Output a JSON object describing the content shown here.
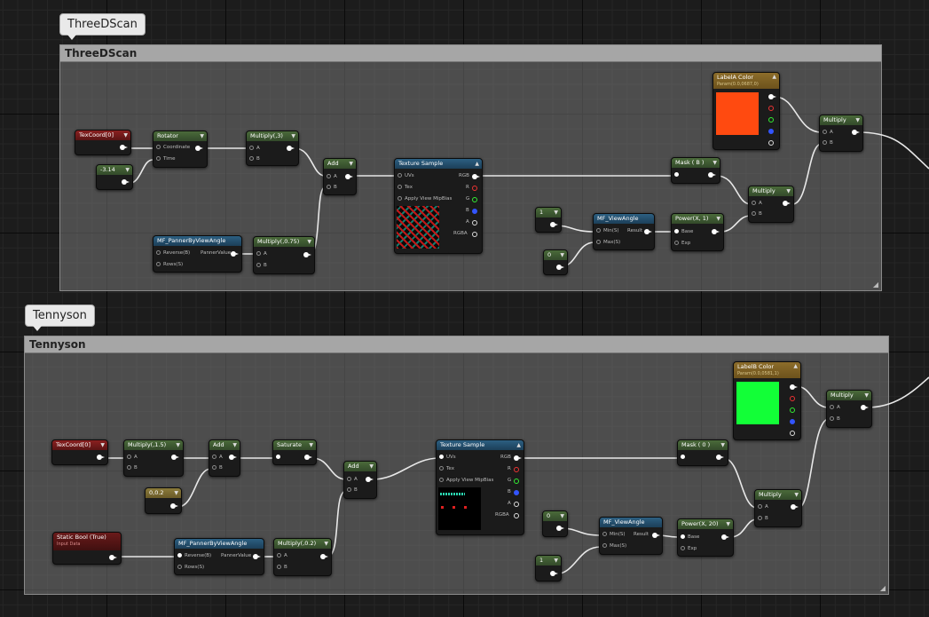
{
  "colors": {
    "labelA": "#ff4a10",
    "labelB": "#12ff37",
    "wire": "#e8e8e8"
  },
  "groups": {
    "top": {
      "bubble": "ThreeDScan",
      "title": "ThreeDScan",
      "nodes": {
        "texcoord": "TexCoord[0]",
        "rotator": "Rotator",
        "rot_coord": "Coordinate",
        "rot_time": "Time",
        "const_neg": "-3.14",
        "mult3": "Multiply(,3)",
        "mult3_a": "A",
        "mult3_b": "B",
        "add": "Add",
        "add_a": "A",
        "add_b": "B",
        "panner": "MF_PannerByViewAngle",
        "pan_rev": "Reverse(B)",
        "pan_rows": "Rows(S)",
        "pan_out": "PannerValue",
        "mult075": "Multiply(,0.75)",
        "m075_a": "A",
        "m075_b": "B",
        "texsample": "Texture Sample",
        "ts_uvs": "UVs",
        "ts_tex": "Tex",
        "ts_mip": "Apply View MipBias",
        "ts_rgb": "RGB",
        "ts_r": "R",
        "ts_g": "G",
        "ts_b": "B",
        "ts_a": "A",
        "ts_rgba": "RGBA",
        "mask": "Mask ( B )",
        "labelA": "LabelA Color",
        "labelA_sub": "Param(0.0,0687,0)",
        "multA": "Multiply",
        "multA_a": "A",
        "multA_b": "B",
        "multB": "Multiply",
        "multB_a": "A",
        "multB_b": "B",
        "const1": "1",
        "const0": "0",
        "viewangle": "MF_ViewAngle",
        "va_min": "Min(S)",
        "va_max": "Max(S)",
        "va_out": "Result",
        "power": "Power(X, 1)",
        "pw_base": "Base",
        "pw_exp": "Exp"
      }
    },
    "bottom": {
      "bubble": "Tennyson",
      "title": "Tennyson",
      "nodes": {
        "texcoord": "TexCoord[0]",
        "mult15": "Multiply(,1.5)",
        "m15_a": "A",
        "m15_b": "B",
        "add1": "Add",
        "add1_a": "A",
        "add1_b": "B",
        "saturate": "Saturate",
        "add2": "Add",
        "add2_a": "A",
        "add2_b": "B",
        "const02": "0,0.2",
        "staticbool": "Static Bool (True)",
        "staticbool_sub": "Input Data",
        "panner": "MF_PannerByViewAngle",
        "pan_rev": "Reverse(B)",
        "pan_rows": "Rows(S)",
        "pan_out": "PannerValue",
        "mult02": "Multiply(,0.2)",
        "m02_a": "A",
        "m02_b": "B",
        "texsample": "Texture Sample",
        "ts_uvs": "UVs",
        "ts_tex": "Tex",
        "ts_mip": "Apply View MipBias",
        "ts_rgb": "RGB",
        "ts_r": "R",
        "ts_g": "G",
        "ts_b": "B",
        "ts_a": "A",
        "ts_rgba": "RGBA",
        "mask": "Mask ( 0 )",
        "labelB": "LabelB Color",
        "labelB_sub": "Param(0.0,0581,1)",
        "multA": "Multiply",
        "multA_a": "A",
        "multA_b": "B",
        "multB": "Multiply",
        "multB_a": "A",
        "multB_b": "B",
        "const0": "0",
        "const1": "1",
        "viewangle": "MF_ViewAngle",
        "va_min": "Min(S)",
        "va_max": "Max(S)",
        "va_out": "Result",
        "power": "Power(X, 20)",
        "pw_base": "Base",
        "pw_exp": "Exp"
      }
    }
  }
}
